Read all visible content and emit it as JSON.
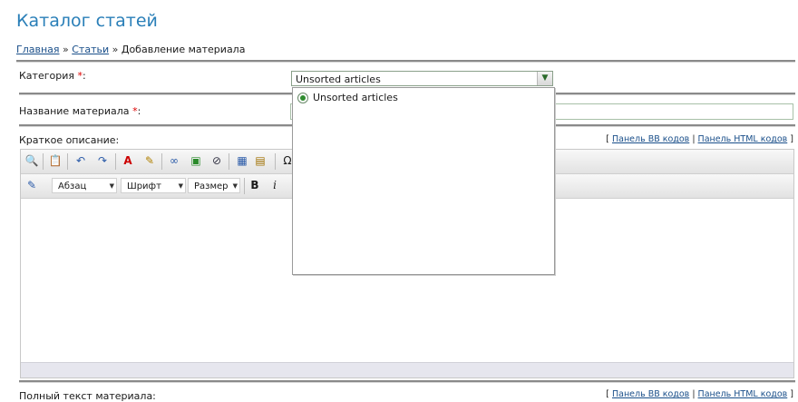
{
  "page": {
    "title": "Каталог статей",
    "breadcrumb": {
      "home": "Главная",
      "articles": "Статьи",
      "current": "Добавление материала",
      "separator": "»"
    }
  },
  "form": {
    "category_label": "Категория",
    "required_marker": "*",
    "colon": ":",
    "category_value": "Unsorted articles",
    "category_options": [
      "Unsorted articles"
    ],
    "title_label": "Название материала",
    "short_label": "Краткое описание:",
    "full_label": "Полный текст материала:"
  },
  "panels": {
    "bb_label": "Панель BB кодов",
    "html_label": "Панель HTML кодов",
    "open_bracket": "[",
    "close_bracket": "]",
    "divider": "|"
  },
  "editor": {
    "format_select": "Абзац",
    "font_select": "Шрифт",
    "size_select": "Размер",
    "bold": "B",
    "italic": "i",
    "omega": "Ω"
  }
}
